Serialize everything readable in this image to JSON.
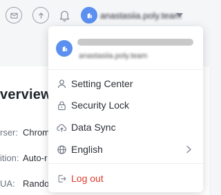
{
  "topbar": {
    "icons": [
      "mail-icon",
      "upload-icon",
      "bell-icon"
    ],
    "username": "anastasiia.poly.team"
  },
  "background": {
    "title": "verview",
    "fields": [
      {
        "label": "rser:",
        "value": "Chrom"
      },
      {
        "label": "ition:",
        "value": "Auto-r"
      },
      {
        "label": "UA:",
        "value": "Rando"
      }
    ]
  },
  "dropdown": {
    "email": "anastasiia.poly.team",
    "items": [
      {
        "label": "Setting Center",
        "icon": "user-icon"
      },
      {
        "label": "Security Lock",
        "icon": "lock-icon"
      },
      {
        "label": "Data Sync",
        "icon": "cloud-sync-icon"
      },
      {
        "label": "English",
        "icon": "globe-icon"
      }
    ],
    "logout": {
      "label": "Log out",
      "icon": "logout-icon"
    }
  },
  "colors": {
    "accent": "#5b8ff0",
    "danger": "#e0392e",
    "text": "#2b2f36"
  }
}
